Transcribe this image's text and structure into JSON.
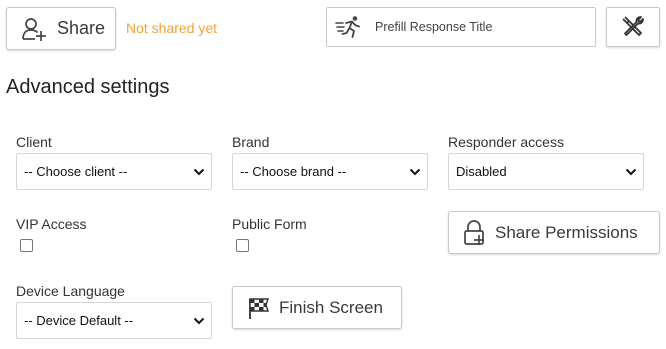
{
  "toolbar": {
    "share_label": "Share",
    "share_status": "Not shared yet",
    "prefill_label": "Prefill Response Title"
  },
  "section": {
    "title": "Advanced settings"
  },
  "fields": {
    "client": {
      "label": "Client",
      "value": "-- Choose client --"
    },
    "brand": {
      "label": "Brand",
      "value": "-- Choose brand --"
    },
    "responder_access": {
      "label": "Responder access",
      "value": "Disabled"
    },
    "vip_access": {
      "label": "VIP Access",
      "checked": false
    },
    "public_form": {
      "label": "Public Form",
      "checked": false
    },
    "share_permissions_label": "Share Permissions",
    "device_language": {
      "label": "Device Language",
      "value": "-- Device Default --"
    },
    "finish_screen_label": "Finish Screen"
  },
  "icons": {
    "share": "add-user-icon",
    "prefill": "runner-icon",
    "tools": "tools-crossed-icon",
    "lock": "lock-plus-icon",
    "finish": "checkered-flag-icon"
  },
  "colors": {
    "status": "#f0a23b",
    "border": "#c8c8c8"
  }
}
